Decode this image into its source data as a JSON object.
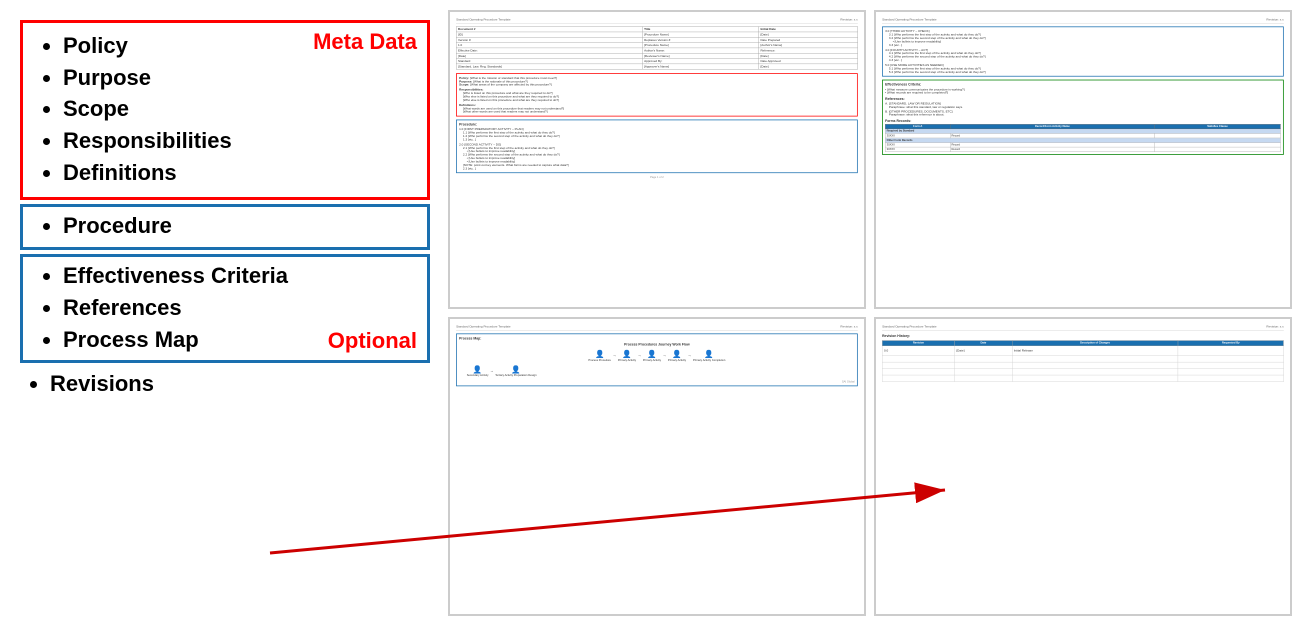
{
  "left": {
    "meta_data_label": "Meta Data",
    "optional_label": "Optional",
    "red_box_items": [
      {
        "id": "policy",
        "label": "Policy"
      },
      {
        "id": "purpose",
        "label": "Purpose"
      },
      {
        "id": "scope",
        "label": "Scope"
      },
      {
        "id": "responsibilities",
        "label": "Responsibilities"
      },
      {
        "id": "definitions",
        "label": "Definitions"
      }
    ],
    "procedure_label": "Procedure",
    "blue_box_items": [
      {
        "id": "effectiveness",
        "label": "Effectiveness Criteria"
      },
      {
        "id": "references",
        "label": "References"
      },
      {
        "id": "process-map",
        "label": "Process Map"
      }
    ],
    "revisions_label": "Revisions"
  },
  "docs": {
    "page1": {
      "header_left": "Standard Operating Procedure Template",
      "header_right": "Revision: x.x",
      "table_rows": [
        {
          "col1": "Document #",
          "col2": "Title",
          "col3": "Initial Date"
        },
        {
          "col1": "[ID]",
          "col2": "[Procedure Name]",
          "col3": "[Date]"
        },
        {
          "col1": "Version #",
          "col2": "Replaces Version #",
          "col3": "Date Prepared"
        },
        {
          "col1": "1.0",
          "col2": "[Procedure Name]",
          "col3": "[Author's Name]"
        },
        {
          "col1": "Effective Date:",
          "col2": "Author's Name:",
          "col3": "Reference:"
        },
        {
          "col1": "[Date]",
          "col2": "[Reviewer's Name]",
          "col3": "[Date]"
        },
        {
          "col1": "Standard",
          "col2": "Approved By:",
          "col3": "Date Approved"
        },
        {
          "col1": "[Standard, Law, Reg, Standards]",
          "col2": "[Approver's Name]",
          "col3": "[Date]"
        }
      ],
      "policy_label": "Policy:",
      "policy_text": "[What is the mission or standard that this procedure must meet?]",
      "purpose_label": "Purpose:",
      "purpose_text": "[What is the rationale of this procedure?]",
      "scope_label": "Scope:",
      "scope_text": "[What areas of the company are affected by this procedure?]",
      "responsibilities_label": "Responsibilities:",
      "resp_items": [
        "[Who is listed on this procedure and what are they required to do?]",
        "[Who else is listed on this procedure and what are they required to do?]",
        "[Who else is listed on this procedure and what are they required to do?]"
      ],
      "definitions_label": "Definitions:",
      "def_items": [
        "[What words are used on this procedure that readers may not understand?]",
        "[What other words are used that readers may not understand?]"
      ]
    },
    "page2": {
      "header_left": "Standard Operating Procedure Template",
      "header_right": "Revision: x.x",
      "procedure_label": "Procedure:",
      "activities": [
        {
          "num": "1.0",
          "title": "[FIRST PREPARATORY ACTIVITY – PLAN]",
          "steps": [
            "1.1  [Who performs the first step of the activity and what do they do?]",
            "1.2  [Who performs the second step of the activity and what do they do?]",
            "1.3  [etc. .]"
          ]
        },
        {
          "num": "2.0",
          "title": "[SECOND ACTIVITY – DO]",
          "steps": [
            "2.1  [Who performs the first step of the activity and what do they do?]",
            "     • [Use bullets to improve readability]",
            "2.2  [Who performs the second step of the activity and what do they do?]",
            "     • [Use bullets to improve readability]",
            "     • [Use bullets to improve readability]",
            "     [NOTE: point out key elements, What forms are needed to capture what data?]",
            "2.3  [etc. .]"
          ]
        }
      ],
      "page_footer": "Page 1 of 2"
    },
    "page3": {
      "header_left": "Standard Operating Procedure Template",
      "header_right": "Revision: x.x",
      "activities": [
        {
          "num": "3.0",
          "title": "[THIRD ACTIVITY – CHECK]",
          "steps": [
            "3.1  [Who performs the first step of the activity and what do they do?]",
            "3.2  [Who performs the second step of the activity and what do they do?]",
            "     • [Use bullets to improve readability]",
            "3.3  [etc. .]"
          ]
        },
        {
          "num": "4.0",
          "title": "[FOURTH ACTIVITY – ACT]",
          "steps": [
            "4.1  [Who performs the first step of the activity and what do they do?]",
            "4.2  [Who performs the second step of the activity and what do they do?]",
            "4.3  [etc. .]"
          ]
        },
        {
          "num": "5.0",
          "title": "[USE MORE ACTIVITIES AS NEEDED]",
          "steps": [
            "5.1  [Who performs the first step of the activity and what do they do?]",
            "5.2  [Who performs the second step of the activity and what do they do?]"
          ]
        }
      ],
      "effectiveness_label": "Effectiveness Criteria:",
      "effectiveness_items": [
        "• [What measure communicates the procedure is working?]",
        "• [What records are required to be completed?]"
      ],
      "references_label": "References:",
      "ref_items": [
        "A.  [STANDARD, LAW OR REGULATION]",
        "    Paraphrase: what this standard, law or regulation says.",
        "B.  [OTHER PROCEDURES, DOCUMENTS, ETC]",
        "    Paraphrase: what this reference is about."
      ],
      "forms_label": "Forms Records:",
      "forms_headers": [
        "Form A",
        "Record/Form Activity Name",
        "Satisfies Clause"
      ],
      "forms_sections": [
        {
          "section": "Required by Standard",
          "rows": [
            [
              "30XXX",
              "Record",
              ""
            ]
          ]
        },
        {
          "section": "Other Form Records",
          "rows": [
            [
              "30XXX",
              "Record",
              ""
            ],
            [
              "30XXX",
              "Record",
              ""
            ]
          ]
        }
      ]
    },
    "page4_process": {
      "header_left": "Standard Operating Procedure Template",
      "header_right": "Revision: x.x",
      "process_map_label": "Process Map:",
      "process_map_title": "Process Procedures Journey Work Flow",
      "flow_items": [
        "Process Procedure",
        "Primary Activity",
        "Primary Activity",
        "Primary Activity",
        "Primary Activity Completion",
        "Secondary Activity",
        "Tertiary Activity Preparation Design"
      ]
    },
    "page5_revision": {
      "header_left": "Standard Operating Procedure Template",
      "header_right": "Revision: x.x",
      "revision_history_label": "Revision History:",
      "table_headers": [
        "Revision",
        "Date",
        "Description of Changes",
        "Requested By"
      ],
      "table_rows": [
        {
          "rev": "0.0",
          "date": "[Date]",
          "desc": "Initial Release",
          "by": ""
        },
        {
          "rev": "",
          "date": "",
          "desc": "",
          "by": ""
        },
        {
          "rev": "",
          "date": "",
          "desc": "",
          "by": ""
        },
        {
          "rev": "",
          "date": "",
          "desc": "",
          "by": ""
        },
        {
          "rev": "",
          "date": "",
          "desc": "",
          "by": ""
        }
      ]
    }
  },
  "arrow": {
    "color": "#cc0000",
    "label": ""
  }
}
